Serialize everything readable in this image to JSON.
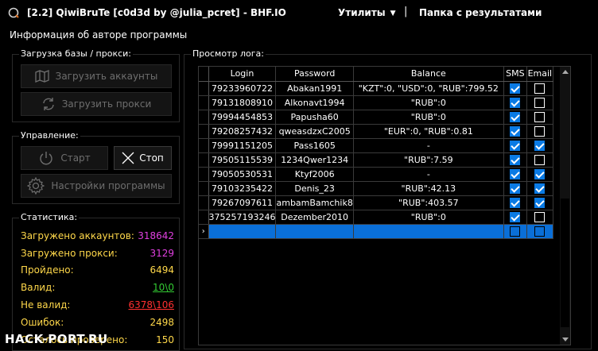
{
  "titlebar": {
    "title": "[2.2]  QiwiBruTe [c0d3d by @julia_pcret] - BHF.IO",
    "menu_utils": "Утилиты",
    "menu_sep": "|",
    "menu_folder": "Папка с результатами"
  },
  "author_link": "Информация об авторе программы",
  "load_group": {
    "title": "Загрузка базы / прокси:",
    "load_accounts": "Загрузить аккаунты",
    "load_proxy": "Загрузить прокси"
  },
  "control_group": {
    "title": "Управление:",
    "start": "Старт",
    "stop": "Стоп",
    "settings": "Настройки программы"
  },
  "stats_group": {
    "title": "Статистика:",
    "items": [
      {
        "label": "Загружено аккаунтов:",
        "value": "318642",
        "color": "#e040e0"
      },
      {
        "label": "Загружено прокси:",
        "value": "3129",
        "color": "#e040e0"
      },
      {
        "label": "Пройдено:",
        "value": "6494",
        "color": "#ffd84a"
      },
      {
        "label": "Валид:",
        "value": "10\\0",
        "color": "#33cc33"
      },
      {
        "label": "Не валид:",
        "value": "6378\\106",
        "color": "#ff3030"
      },
      {
        "label": "Ошибок:",
        "value": "2498",
        "color": "#ffd84a"
      },
      {
        "label": "Осталось проверено:",
        "value": "150",
        "color": "#ffd84a"
      }
    ]
  },
  "log_group": {
    "title": "Просмотр лога:",
    "columns": [
      "Login",
      "Password",
      "Balance",
      "SMS",
      "Email"
    ],
    "rows": [
      {
        "login": "79233960722",
        "password": "Abakan1991",
        "balance": "\"KZT\":0, \"USD\":0, \"RUB\":799.52",
        "sms": true,
        "email": false
      },
      {
        "login": "79131808910",
        "password": "Alkonavt1994",
        "balance": "\"RUB\":0",
        "sms": true,
        "email": false
      },
      {
        "login": "79994454853",
        "password": "Papusha60",
        "balance": "\"RUB\":0",
        "sms": true,
        "email": false
      },
      {
        "login": "79208257432",
        "password": "qweasdzxC2005",
        "balance": "\"EUR\":0, \"RUB\":0.81",
        "sms": true,
        "email": false
      },
      {
        "login": "79991151205",
        "password": "Pass1605",
        "balance": "-",
        "sms": true,
        "email": true
      },
      {
        "login": "79505115539",
        "password": "1234Qwer1234",
        "balance": "\"RUB\":7.59",
        "sms": true,
        "email": false
      },
      {
        "login": "79050530531",
        "password": "Ktyf2006",
        "balance": "-",
        "sms": true,
        "email": true
      },
      {
        "login": "79103235422",
        "password": "Denis_23",
        "balance": "\"RUB\":42.13",
        "sms": true,
        "email": true
      },
      {
        "login": "79267097611",
        "password": "ambamBamchik8",
        "balance": "\"RUB\":403.57",
        "sms": true,
        "email": true
      },
      {
        "login": "375257193246",
        "password": "Dezember2010",
        "balance": "\"RUB\":0",
        "sms": true,
        "email": false
      }
    ]
  },
  "watermark": "HACK-PORT.RU"
}
